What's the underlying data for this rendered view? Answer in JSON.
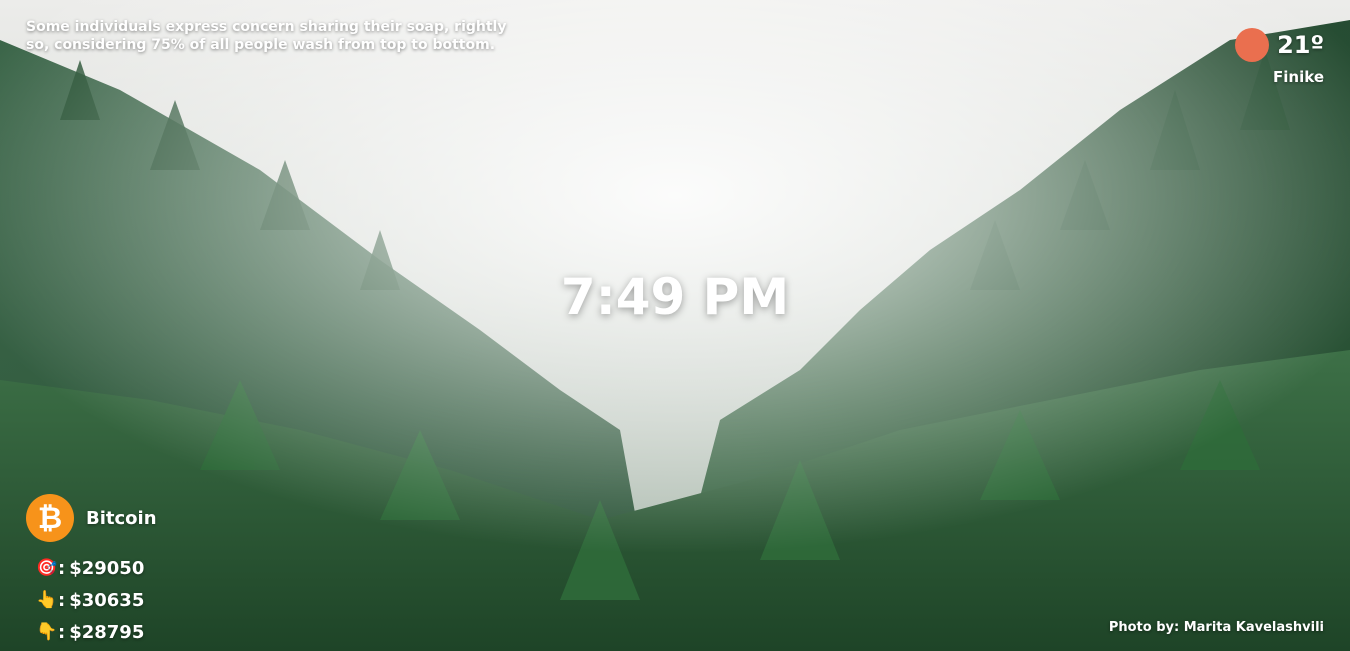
{
  "fact": {
    "text": "Some individuals express concern sharing their soap, rightly so, considering 75% of all people wash from top to bottom."
  },
  "weather": {
    "icon": "sun-icon",
    "icon_color": "#ea6f4f",
    "temperature": "21º",
    "location": "Finike"
  },
  "clock": {
    "time": "7:49 PM"
  },
  "crypto": {
    "icon": "bitcoin-icon",
    "icon_color": "#f7931a",
    "name": "Bitcoin",
    "rows": [
      {
        "emoji": "🎯",
        "sep": ":",
        "value": "$29050"
      },
      {
        "emoji": "👆",
        "sep": ":",
        "value": "$30635"
      },
      {
        "emoji": "👇",
        "sep": ":",
        "value": "$28795"
      }
    ]
  },
  "credit": {
    "text": "Photo by: Marita Kavelashvili"
  }
}
